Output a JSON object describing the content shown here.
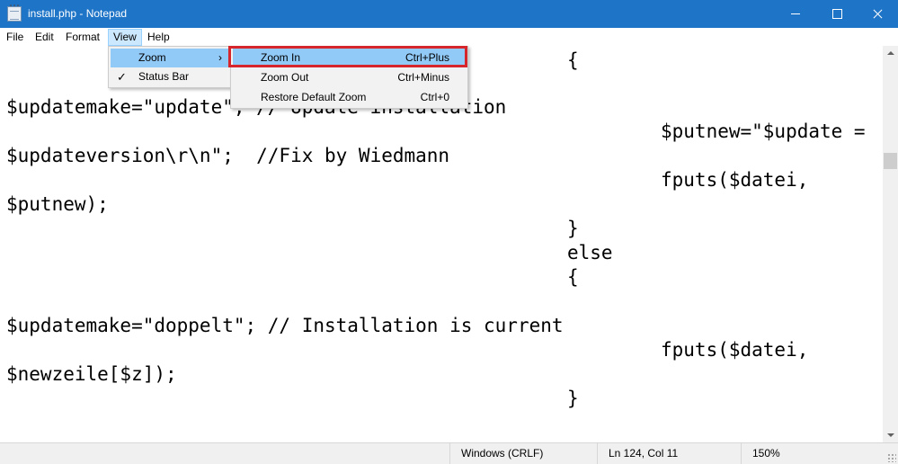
{
  "window": {
    "title": "install.php - Notepad",
    "icon": "notepad-icon"
  },
  "menubar": {
    "items": [
      "File",
      "Edit",
      "Format",
      "View",
      "Help"
    ],
    "active": "View"
  },
  "view_menu": {
    "items": [
      {
        "label": "Zoom",
        "submenu": true,
        "checked": false
      },
      {
        "label": "Status Bar",
        "submenu": false,
        "checked": true
      }
    ],
    "check_glyph": "✓",
    "chevron_glyph": "›"
  },
  "zoom_menu": {
    "items": [
      {
        "label": "Zoom In",
        "shortcut": "Ctrl+Plus"
      },
      {
        "label": "Zoom Out",
        "shortcut": "Ctrl+Minus"
      },
      {
        "label": "Restore Default Zoom",
        "shortcut": "Ctrl+0"
      }
    ],
    "highlighted": "Zoom In",
    "highlight_outline_color": "#d6262b"
  },
  "editor": {
    "lines": [
      "{",
      "$updatemake=\"update\"; // Update installation",
      "$putnew=\"$update =",
      "$updateversion\\r\\n\";  //Fix by Wiedmann",
      "fputs($datei,",
      "$putnew);",
      "}",
      "else",
      "{",
      "$updatemake=\"doppelt\"; // Installation is current",
      "fputs($datei,",
      "$newzeile[$z]);",
      "}"
    ]
  },
  "statusbar": {
    "line_ending": "Windows (CRLF)",
    "position": "Ln 124, Col 11",
    "zoom": "150%"
  },
  "colors": {
    "titlebar": "#1e74c7",
    "menu_highlight": "#91c9f7",
    "zoom_in_outline": "#d6262b"
  }
}
